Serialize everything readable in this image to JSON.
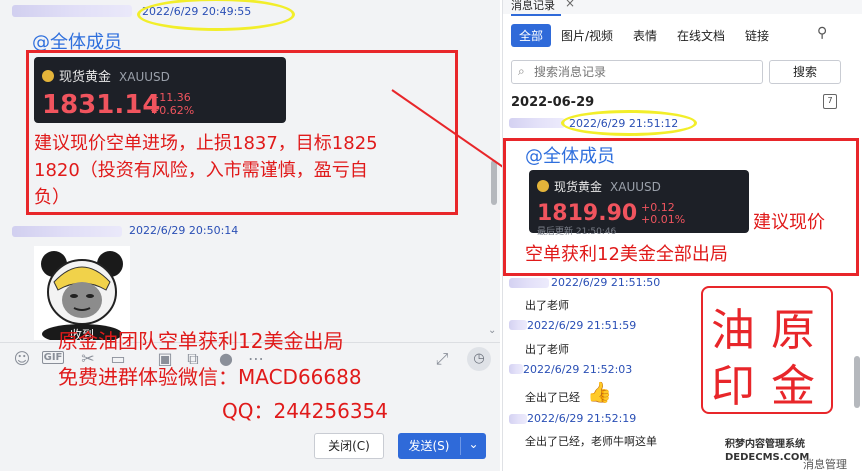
{
  "left": {
    "msg1": {
      "timestamp": "2022/6/29 20:49:55",
      "mention": "@全体成员",
      "card": {
        "name": "现货黄金",
        "symbol": "XAUUSD",
        "price": "1831.14",
        "change": "+11.36",
        "change_pct": "+0.62%"
      },
      "text_lines": [
        "建议现价空单进场，止损1837，目标1825",
        "1820（投资有风险，入市需谨慎，盈亏自",
        "负）"
      ]
    },
    "msg2": {
      "timestamp": "2022/6/29 20:50:14",
      "sticker_caption": "收到"
    },
    "toolbar_icons": [
      "smile-icon",
      "gif-icon",
      "scissors-icon",
      "folder-icon",
      "image-icon",
      "screenshot-icon",
      "mic-icon",
      "more-icon",
      "expand-icon",
      "history-icon"
    ],
    "toolbar_labels": {
      "gif": "GIF"
    },
    "buttons": {
      "close": "关闭(C)",
      "send": "发送(S)",
      "send_dropdown": "⌄"
    }
  },
  "overlay": {
    "line1": "原金油团队空单获利12美金出局",
    "line2": "免费进群体验微信：MACD66688",
    "line3": "QQ：244256354"
  },
  "right": {
    "title_tab": "消息记录",
    "tab_close": "×",
    "filters": [
      "全部",
      "图片/视频",
      "表情",
      "在线文档",
      "链接"
    ],
    "search": {
      "placeholder": "搜索消息记录",
      "button": "搜索"
    },
    "date_header": "2022-06-29",
    "msgs": [
      {
        "ts": "2022/6/29 21:51:12",
        "mention": "@全体成员",
        "card": {
          "name": "现货黄金",
          "symbol": "XAUUSD",
          "price": "1819.90",
          "change": "+0.12",
          "change_pct": "+0.01%",
          "note": "最后更新 21:50:46"
        },
        "text_lines": [
          "建议现价",
          "空单获利12美金全部出局"
        ]
      },
      {
        "ts": "2022/6/29 21:51:50",
        "text": "出了老师"
      },
      {
        "ts": "2022/6/29 21:51:59",
        "text": "出了老师"
      },
      {
        "ts": "2022/6/29 21:52:03",
        "text": "全出了已经"
      },
      {
        "ts": "2022/6/29 21:52:19",
        "text": "全出了已经，老师牛啊这单"
      }
    ],
    "seal": [
      "油",
      "原",
      "印",
      "金"
    ],
    "watermark": "积梦内容管理系统 DEDECMS.COM",
    "bottom_link": "消息管理"
  }
}
